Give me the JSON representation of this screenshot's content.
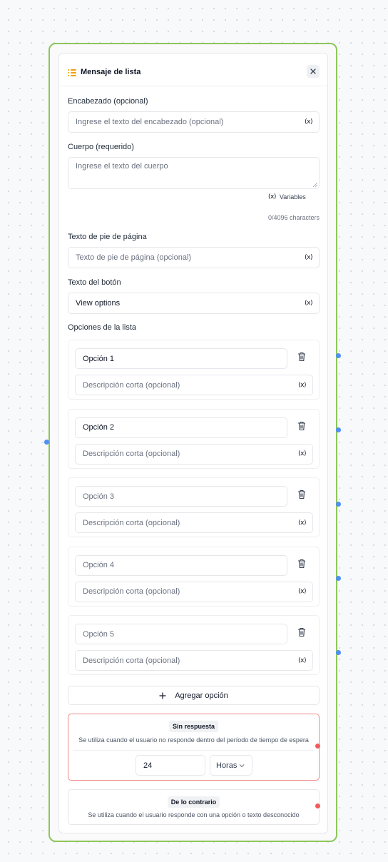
{
  "header": {
    "title": "Mensaje de lista"
  },
  "fields": {
    "header_label": "Encabezado (opcional)",
    "header_placeholder": "Ingrese el texto del encabezado (opcional)",
    "body_label": "Cuerpo (requerido)",
    "body_placeholder": "Ingrese el texto del cuerpo",
    "variables_label": "Variables",
    "char_count": "0/4096 characters",
    "footer_label": "Texto de pie de página",
    "footer_placeholder": "Texto de pie de página (opcional)",
    "button_label": "Texto del botón",
    "button_value": "View options",
    "options_label": "Opciones de la lista"
  },
  "options": [
    {
      "title": "Opción 1",
      "filled": true,
      "description_placeholder": "Descripción corta (opcional)"
    },
    {
      "title": "Opción 2",
      "filled": true,
      "description_placeholder": "Descripción corta (opcional)"
    },
    {
      "title": "Opción 3",
      "filled": false,
      "description_placeholder": "Descripción corta (opcional)"
    },
    {
      "title": "Opción 4",
      "filled": false,
      "description_placeholder": "Descripción corta (opcional)"
    },
    {
      "title": "Opción 5",
      "filled": false,
      "description_placeholder": "Descripción corta (opcional)"
    }
  ],
  "add_option_label": "Agregar opción",
  "no_response": {
    "tag": "Sin respuesta",
    "note": "Se utiliza cuando el usuario no responde dentro del período de tiempo de espera",
    "value": "24",
    "unit": "Horas"
  },
  "otherwise": {
    "tag": "De lo contrario",
    "note": "Se utiliza cuando el usuario responde con una opción o texto desconocido"
  },
  "icons": {
    "title": "list-icon",
    "close": "close-icon",
    "variable": "variable-icon",
    "delete": "trash-icon",
    "add": "plus-icon",
    "dropdown": "chevron-down-icon"
  },
  "colors": {
    "node_border": "#8dc65b",
    "title_icon": "#f59e0b",
    "handle": "#4f8ff7",
    "timeout_border": "#f08a8a",
    "error_handle": "#ef5b5b"
  }
}
